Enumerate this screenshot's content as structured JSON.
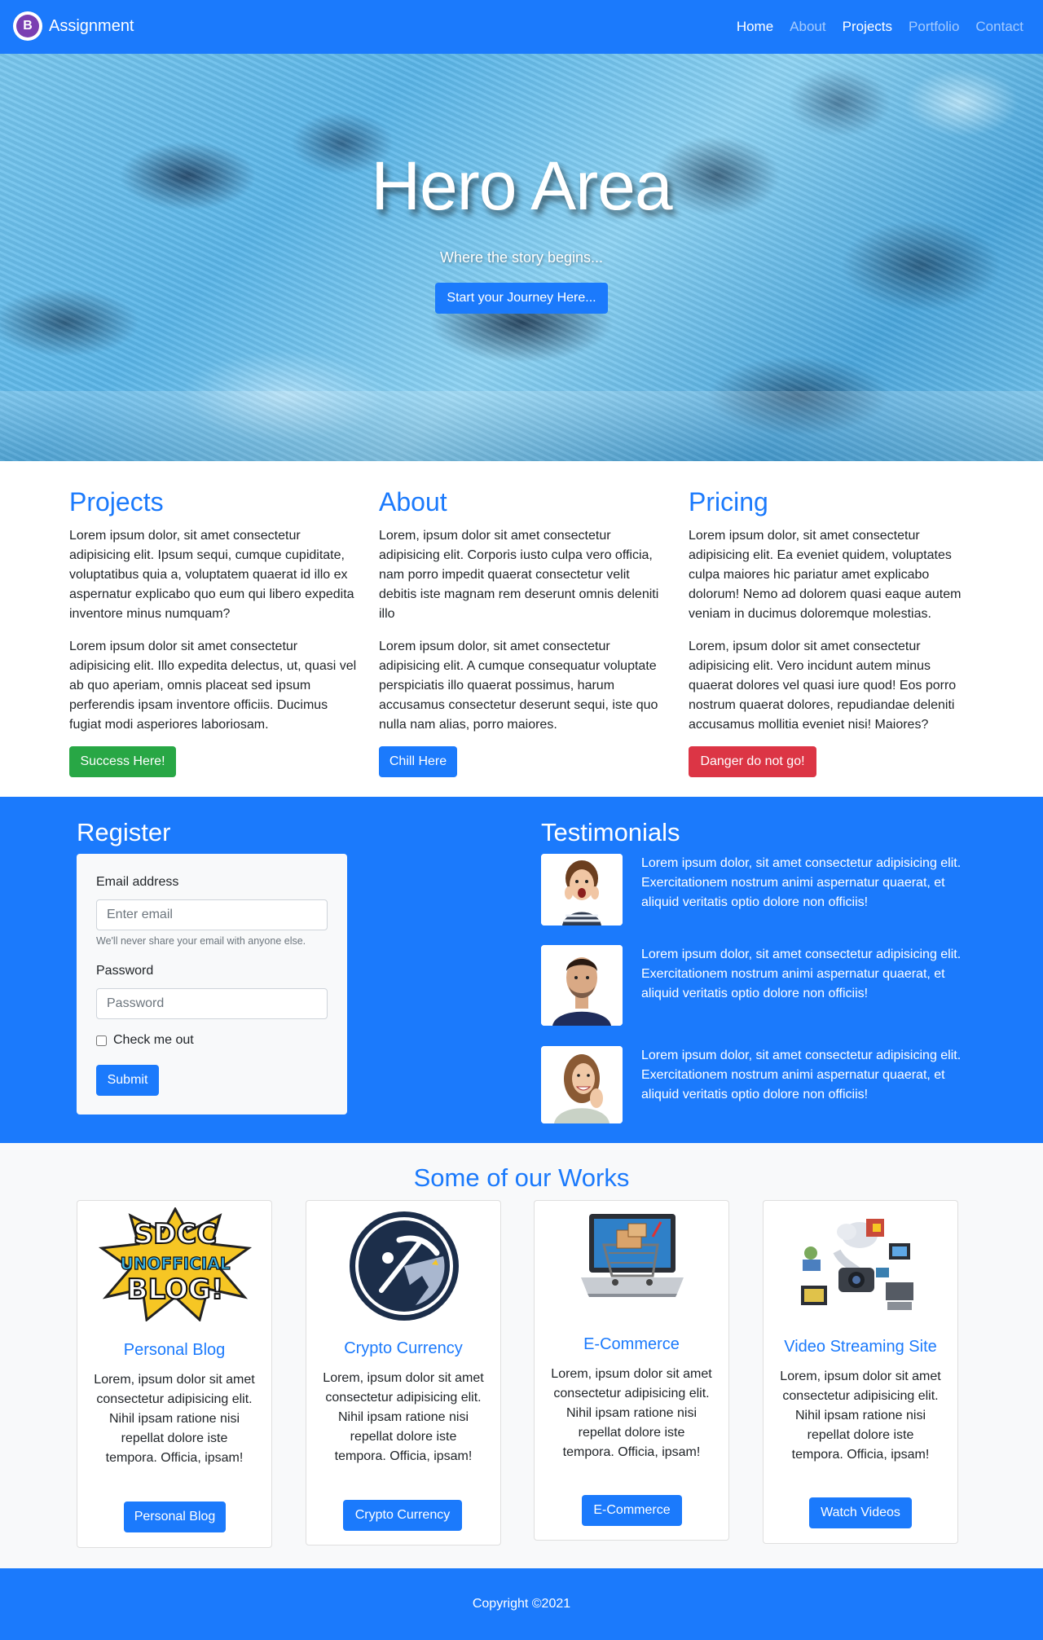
{
  "navbar": {
    "brand_initial": "B",
    "brand": "Assignment",
    "links": [
      "Home",
      "About",
      "Projects",
      "Portfolio",
      "Contact"
    ]
  },
  "hero": {
    "title": "Hero Area",
    "subtitle": "Where the story begins...",
    "button": "Start your Journey Here..."
  },
  "columns": [
    {
      "title": "Projects",
      "p1": "Lorem ipsum dolor, sit amet consectetur adipisicing elit. Ipsum sequi, cumque cupiditate, voluptatibus quia a, voluptatem quaerat id illo ex aspernatur explicabo quo eum qui libero expedita inventore minus numquam?",
      "p2": "Lorem ipsum dolor sit amet consectetur adipisicing elit. Illo expedita delectus, ut, quasi vel ab quo aperiam, omnis placeat sed ipsum perferendis ipsam inventore officiis. Ducimus fugiat modi asperiores laboriosam.",
      "button": "Success Here!"
    },
    {
      "title": "About",
      "p1": "Lorem, ipsum dolor sit amet consectetur adipisicing elit. Corporis iusto culpa vero officia, nam porro impedit quaerat consectetur velit debitis iste magnam rem deserunt omnis deleniti illo",
      "p2": "Lorem ipsum dolor, sit amet consectetur adipisicing elit. A cumque consequatur voluptate perspiciatis illo quaerat possimus, harum accusamus consectetur deserunt sequi, iste quo nulla nam alias, porro maiores.",
      "button": "Chill Here"
    },
    {
      "title": "Pricing",
      "p1": "Lorem ipsum dolor, sit amet consectetur adipisicing elit. Ea eveniet quidem, voluptates culpa maiores hic pariatur amet explicabo dolorum! Nemo ad dolorem quasi eaque autem veniam in ducimus doloremque molestias.",
      "p2": "Lorem, ipsum dolor sit amet consectetur adipisicing elit. Vero incidunt autem minus quaerat dolores vel quasi iure quod! Eos porro nostrum quaerat dolores, repudiandae deleniti accusamus mollitia eveniet nisi! Maiores?",
      "button": "Danger do not go!"
    }
  ],
  "register": {
    "title": "Register",
    "email_label": "Email address",
    "email_placeholder": "Enter email",
    "email_help": "We'll never share your email with anyone else.",
    "password_label": "Password",
    "password_placeholder": "Password",
    "check_label": "Check me out",
    "submit": "Submit"
  },
  "testimonials": {
    "title": "Testimonials",
    "items": [
      "Lorem ipsum dolor, sit amet consectetur adipisicing elit. Exercitationem nostrum animi aspernatur quaerat, et aliquid veritatis optio dolore non officiis!",
      "Lorem ipsum dolor, sit amet consectetur adipisicing elit. Exercitationem nostrum animi aspernatur quaerat, et aliquid veritatis optio dolore non officiis!",
      "Lorem ipsum dolor, sit amet consectetur adipisicing elit. Exercitationem nostrum animi aspernatur quaerat, et aliquid veritatis optio dolore non officiis!"
    ]
  },
  "works": {
    "title": "Some of our Works",
    "sdcc_top": "SDCC",
    "sdcc_mid": "UNOFFICIAL",
    "sdcc_bottom": "BLOG!",
    "cards": [
      {
        "title": "Personal Blog",
        "text": "Lorem, ipsum dolor sit amet consectetur adipisicing elit. Nihil ipsam ratione nisi repellat dolore iste tempora. Officia, ipsam!",
        "button": "Personal Blog"
      },
      {
        "title": "Crypto Currency",
        "text": "Lorem, ipsum dolor sit amet consectetur adipisicing elit. Nihil ipsam ratione nisi repellat dolore iste tempora. Officia, ipsam!",
        "button": "Crypto Currency"
      },
      {
        "title": "E-Commerce",
        "text": "Lorem, ipsum dolor sit amet consectetur adipisicing elit. Nihil ipsam ratione nisi repellat dolore iste tempora. Officia, ipsam!",
        "button": "E-Commerce"
      },
      {
        "title": "Video Streaming Site",
        "text": "Lorem, ipsum dolor sit amet consectetur adipisicing elit. Nihil ipsam ratione nisi repellat dolore iste tempora. Officia, ipsam!",
        "button": "Watch Videos"
      }
    ]
  },
  "footer": {
    "copyright": "Copyright ©2021"
  },
  "colors": {
    "primary": "#1b7afc",
    "success": "#28a745",
    "danger": "#dc3545",
    "light": "#f8f9fa"
  }
}
